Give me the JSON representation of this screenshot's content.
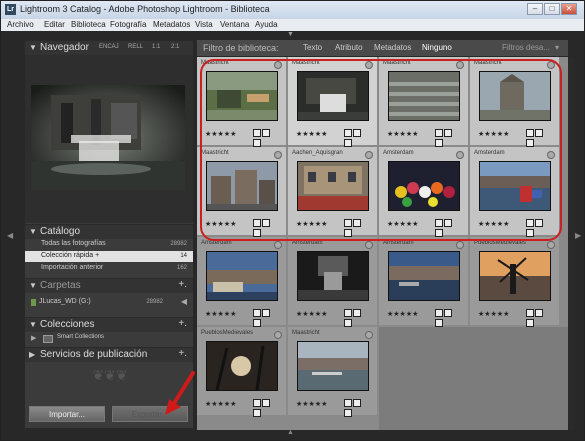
{
  "window": {
    "title": "Lightroom 3 Catalog - Adobe Photoshop Lightroom - Biblioteca",
    "app_icon": "Lr",
    "controls": {
      "minimize": "–",
      "maximize": "□",
      "close": "✕"
    }
  },
  "menu": [
    "Archivo",
    "Editar",
    "Biblioteca",
    "Fotografía",
    "Metadatos",
    "Vista",
    "Ventana",
    "Ayuda"
  ],
  "navigator": {
    "title": "Navegador",
    "options": [
      "ENCAJ",
      "RELL",
      "1:1",
      "2:1"
    ]
  },
  "catalog": {
    "title": "Catálogo",
    "rows": [
      {
        "label": "Todas las fotografías",
        "count": "28982"
      },
      {
        "label": "Colección rápida +",
        "count": "14"
      },
      {
        "label": "Importación anterior",
        "count": "162"
      }
    ]
  },
  "folders": {
    "title": "Carpetas",
    "drive": {
      "label": "JLucas_WD (G:)",
      "count": "28982"
    }
  },
  "collections": {
    "title": "Colecciones",
    "items": [
      {
        "label": "Smart Collections"
      }
    ]
  },
  "publish": {
    "title": "Servicios de publicación"
  },
  "buttons": {
    "import": "Importar...",
    "export": "Exportar..."
  },
  "filter": {
    "label": "Filtro de biblioteca:",
    "tabs": [
      "Texto",
      "Atributo",
      "Metadatos",
      "Ninguno"
    ],
    "active_tab": "Ninguno",
    "preset": "Filtros desa..."
  },
  "thumbnails": [
    {
      "location": "Maastricht",
      "stars": "★★★★★",
      "selected": true
    },
    {
      "location": "Maastricht",
      "stars": "★★★★★",
      "selected": true
    },
    {
      "location": "Maastricht",
      "stars": "★★★★★",
      "selected": true
    },
    {
      "location": "Maastricht",
      "stars": "★★★★★",
      "selected": true
    },
    {
      "location": "Maastricht",
      "stars": "★★★★★",
      "selected": true
    },
    {
      "location": "Aachen_Aquisgran",
      "stars": "★★★★★",
      "selected": true
    },
    {
      "location": "Amsterdam",
      "stars": "★★★★★",
      "selected": true
    },
    {
      "location": "Amsterdam",
      "stars": "★★★★★",
      "selected": true
    },
    {
      "location": "Amsterdam",
      "stars": "★★★★★",
      "selected": false
    },
    {
      "location": "Amsterdam",
      "stars": "★★★★★",
      "selected": false
    },
    {
      "location": "Amsterdam",
      "stars": "★★★★★",
      "selected": false
    },
    {
      "location": "PueblosMedievales",
      "stars": "★★★★★",
      "selected": false
    },
    {
      "location": "PueblosMedievales",
      "stars": "★★★★★",
      "selected": false
    },
    {
      "location": "Maastricht",
      "stars": "★★★★★",
      "selected": false
    }
  ],
  "colors": {
    "highlight": "#cc1f1f",
    "accent": "#e2e2e2"
  }
}
